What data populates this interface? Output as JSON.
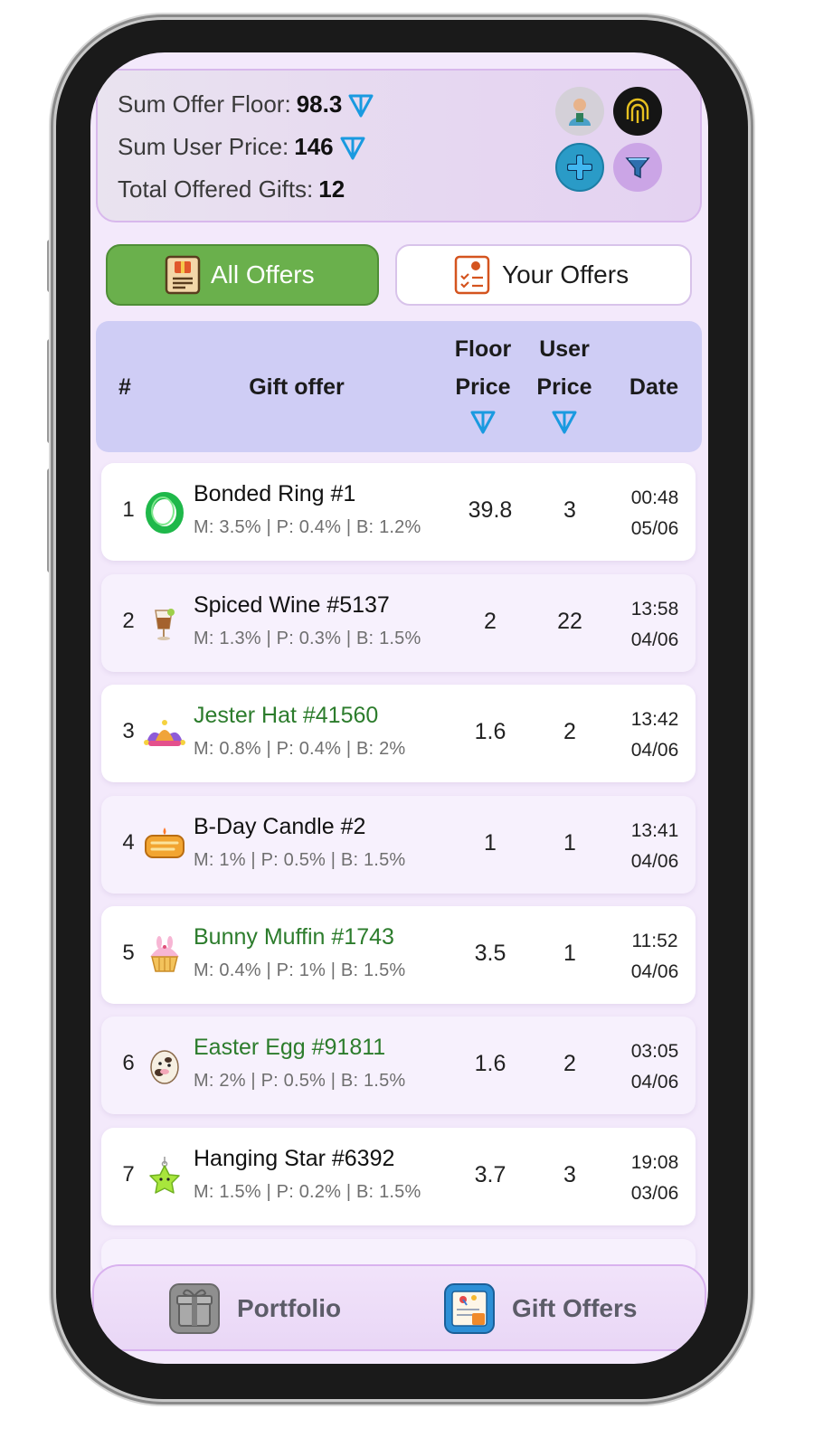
{
  "summary": {
    "sum_offer_floor_label": "Sum Offer Floor:",
    "sum_offer_floor_value": "98.3",
    "sum_user_price_label": "Sum User Price:",
    "sum_user_price_value": "146",
    "total_offered_gifts_label": "Total Offered Gifts:",
    "total_offered_gifts_value": "12",
    "icons": [
      "user-avatar-icon",
      "fingerprint-icon",
      "add-icon",
      "filter-icon"
    ]
  },
  "tabs": {
    "all_offers": "All Offers",
    "your_offers": "Your Offers",
    "active": "all_offers"
  },
  "table": {
    "headers": {
      "num": "#",
      "gift_offer": "Gift offer",
      "floor_1": "Floor",
      "floor_2": "Price",
      "user_1": "User",
      "user_2": "Price",
      "date": "Date"
    },
    "rows": [
      {
        "num": "1",
        "name": "Bonded Ring #1",
        "highlight": false,
        "stats": "M: 3.5% | P: 0.4% | B: 1.2%",
        "floor": "39.8",
        "user": "3",
        "time": "00:48",
        "date": "05/06",
        "icon": "ring-icon"
      },
      {
        "num": "2",
        "name": "Spiced Wine #5137",
        "highlight": false,
        "stats": "M: 1.3% | P: 0.3% | B: 1.5%",
        "floor": "2",
        "user": "22",
        "time": "13:58",
        "date": "04/06",
        "icon": "wine-icon"
      },
      {
        "num": "3",
        "name": "Jester Hat #41560",
        "highlight": true,
        "stats": "M: 0.8% | P: 0.4% | B: 2%",
        "floor": "1.6",
        "user": "2",
        "time": "13:42",
        "date": "04/06",
        "icon": "jester-hat-icon"
      },
      {
        "num": "4",
        "name": "B-Day Candle #2",
        "highlight": false,
        "stats": "M: 1% | P: 0.5% | B: 1.5%",
        "floor": "1",
        "user": "1",
        "time": "13:41",
        "date": "04/06",
        "icon": "bday-candle-icon"
      },
      {
        "num": "5",
        "name": "Bunny Muffin #1743",
        "highlight": true,
        "stats": "M: 0.4% | P: 1% | B: 1.5%",
        "floor": "3.5",
        "user": "1",
        "time": "11:52",
        "date": "04/06",
        "icon": "muffin-icon"
      },
      {
        "num": "6",
        "name": "Easter Egg #91811",
        "highlight": true,
        "stats": "M: 2% | P: 0.5% | B: 1.5%",
        "floor": "1.6",
        "user": "2",
        "time": "03:05",
        "date": "04/06",
        "icon": "easter-egg-icon"
      },
      {
        "num": "7",
        "name": "Hanging Star #6392",
        "highlight": false,
        "stats": "M: 1.5% | P: 0.2% | B: 1.5%",
        "floor": "3.7",
        "user": "3",
        "time": "19:08",
        "date": "03/06",
        "icon": "star-icon"
      }
    ]
  },
  "bottom_nav": {
    "portfolio": "Portfolio",
    "gift_offers": "Gift Offers",
    "active": "gift_offers"
  },
  "colors": {
    "accent_green": "#6ab04c",
    "highlight_text": "#2c7c2c",
    "header_bg": "#cfcdf5",
    "ton_blue": "#1a9ae0"
  }
}
